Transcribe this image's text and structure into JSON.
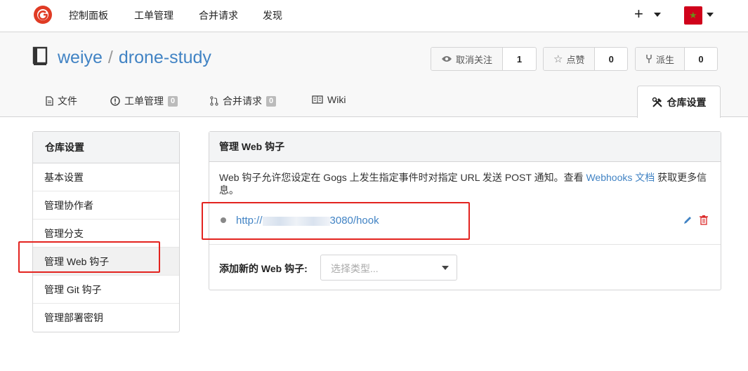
{
  "topnav": {
    "logo_icon": "gogs-logo-icon",
    "items": [
      "控制面板",
      "工单管理",
      "合并请求",
      "发现"
    ],
    "plus_label": "+",
    "accent": "#e03b24"
  },
  "repo": {
    "owner": "weiye",
    "separator": "/",
    "name": "drone-study",
    "icon": "repo-book-icon"
  },
  "stats": [
    {
      "label": "取消关注",
      "count": "1",
      "icon": "eye-icon"
    },
    {
      "label": "点赞",
      "count": "0",
      "icon": "star-icon"
    },
    {
      "label": "派生",
      "count": "0",
      "icon": "fork-icon"
    }
  ],
  "tabs": [
    {
      "label": "文件",
      "icon": "file-icon",
      "badge": ""
    },
    {
      "label": "工单管理",
      "icon": "issue-icon",
      "badge": "0"
    },
    {
      "label": "合并请求",
      "icon": "pull-request-icon",
      "badge": "0"
    },
    {
      "label": "Wiki",
      "icon": "book-icon",
      "badge": ""
    }
  ],
  "active_tab": {
    "label": "仓库设置",
    "icon": "tools-icon"
  },
  "sidebar": {
    "title": "仓库设置",
    "items": [
      {
        "label": "基本设置"
      },
      {
        "label": "管理协作者"
      },
      {
        "label": "管理分支"
      },
      {
        "label": "管理 Web 钩子",
        "active": true
      },
      {
        "label": "管理 Git 钩子"
      },
      {
        "label": "管理部署密钥"
      }
    ]
  },
  "panel": {
    "title": "管理 Web 钩子",
    "desc_before": "Web 钩子允许您设定在 Gogs 上发生指定事件时对指定 URL 发送 POST 通知。查看 ",
    "desc_link": "Webhooks 文档",
    "desc_after": " 获取更多信息。",
    "hook_url_prefix": "http://",
    "hook_url_suffix": "3080/hook",
    "add_label": "添加新的 Web 钩子:",
    "select_placeholder": "选择类型..."
  },
  "colors": {
    "link": "#4183c4",
    "highlight_box": "#e3231f",
    "delete": "#db2828"
  }
}
